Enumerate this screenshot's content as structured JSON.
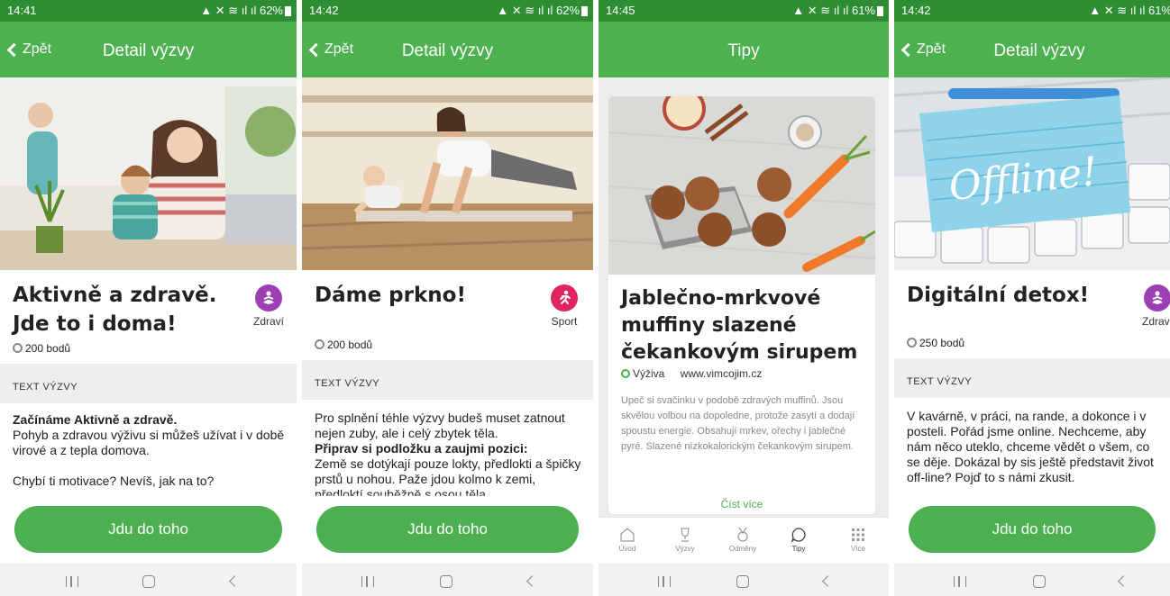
{
  "colors": {
    "statusbar": "#2f8e34",
    "header": "#4db150",
    "button": "#4caf50",
    "section": "#eeeeee"
  },
  "screens": [
    {
      "status": {
        "time": "14:41",
        "right": "62%"
      },
      "back_label": "Zpět",
      "header_title": "Detail výzvy",
      "title_line1": "Aktivně a zdravě.",
      "title_line2": "Jde to i doma!",
      "category": {
        "label": "Zdraví",
        "icon": "meditation-icon",
        "color": "#9c3fb3"
      },
      "points": "200 bodů",
      "section_label": "TEXT VÝZVY",
      "body": {
        "bold": "Začínáme Aktivně a zdravě.",
        "text": "Pohyb a zdravou výživu si můžeš užívat i v době virové a z tepla domova.",
        "text2": "Chybí ti motivace? Nevíš, jak na to?"
      },
      "cta": "Jdu do toho"
    },
    {
      "status": {
        "time": "14:42",
        "right": "62%"
      },
      "back_label": "Zpět",
      "header_title": "Detail výzvy",
      "title_line1": "Dáme prkno!",
      "category": {
        "label": "Sport",
        "icon": "running-icon",
        "color": "#e0245e"
      },
      "points": "200 bodů",
      "section_label": "TEXT VÝZVY",
      "body": {
        "text": "Pro splnění téhle výzvy budeš muset zatnout nejen zuby, ale i celý zbytek těla.",
        "bold": "Připrav si podložku a zaujmi pozici:",
        "text2": "Země se dotýkají pouze lokty, předlokti a špičky prstů u nohou. Paže jdou kolmo k zemi, předloktí souběžně s osou těla."
      },
      "cta": "Jdu do toho"
    },
    {
      "status": {
        "time": "14:45",
        "right": "61%"
      },
      "header_title": "Tipy",
      "tip": {
        "title_line1": "Jablečno-mrkvové",
        "title_line2": "muffiny slazené",
        "title_line3": "čekankovým sirupem",
        "category": "Výživa",
        "source": "www.vimcojim.cz",
        "text": "Upeč si svačinku v podobě zdravých muffinů. Jsou skvělou volbou na dopoledne, protože zasytí a dodají spoustu energie. Obsahují mrkev, ořechy i jablečné pyré. Slazené nízkokalorickým čekankovým sirupem.",
        "read_more": "Číst více"
      },
      "tabs": [
        {
          "label": "Úvod",
          "icon": "home-icon"
        },
        {
          "label": "Výzvy",
          "icon": "trophy-icon"
        },
        {
          "label": "Odměny",
          "icon": "medal-icon"
        },
        {
          "label": "Tipy",
          "icon": "chat-bubble-icon"
        },
        {
          "label": "Více",
          "icon": "grid-icon"
        }
      ]
    },
    {
      "status": {
        "time": "14:42",
        "right": "61%"
      },
      "back_label": "Zpět",
      "header_title": "Detail výzvy",
      "title_line1": "Digitální detox!",
      "category": {
        "label": "Zdraví",
        "icon": "meditation-icon",
        "color": "#9c3fb3"
      },
      "points": "250 bodů",
      "section_label": "TEXT VÝZVY",
      "body": {
        "text": "V kavárně, v práci, na rande, a dokonce i v posteli. Pořád jsme online. Nechceme, aby nám něco uteklo, chceme vědět o všem, co se děje. Dokázal by sis ještě představit život off-line? Pojď to s námi zkusit."
      },
      "hero_text": "Offline!",
      "cta": "Jdu do toho"
    }
  ]
}
